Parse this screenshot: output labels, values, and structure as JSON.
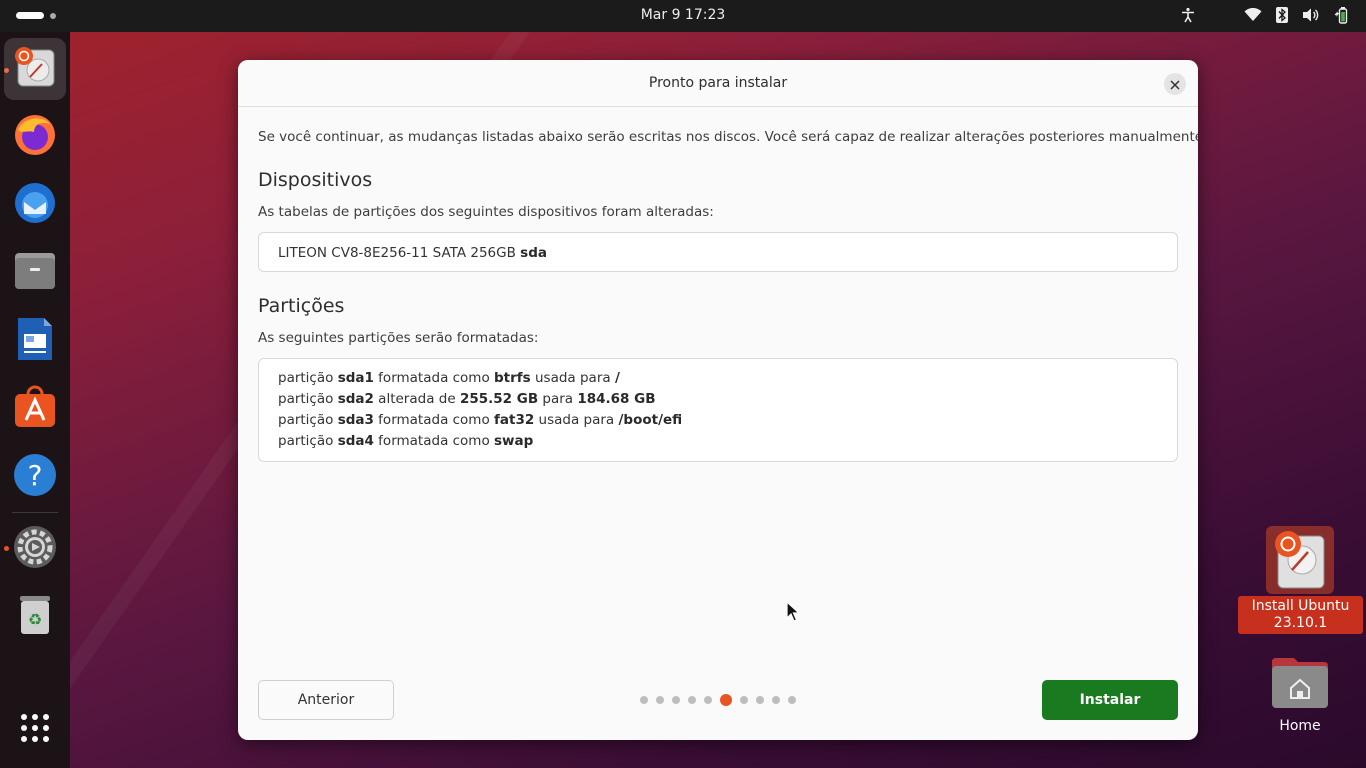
{
  "topbar": {
    "clock": "Mar 9  17:23",
    "tray_icons": [
      "accessibility-icon",
      "wifi-icon",
      "bluetooth-icon",
      "volume-icon",
      "battery-icon"
    ]
  },
  "dock": {
    "items": [
      {
        "name": "install-ubuntu",
        "icon": "installer-icon",
        "running": true,
        "active": true
      },
      {
        "name": "firefox",
        "icon": "firefox-icon"
      },
      {
        "name": "thunderbird",
        "icon": "thunderbird-icon"
      },
      {
        "name": "files",
        "icon": "files-icon"
      },
      {
        "name": "writer",
        "icon": "libreoffice-writer-icon"
      },
      {
        "name": "app-center",
        "icon": "app-center-icon"
      },
      {
        "name": "help",
        "icon": "help-icon"
      },
      {
        "name": "settings",
        "icon": "settings-icon",
        "running": true
      },
      {
        "name": "trash",
        "icon": "trash-icon"
      },
      {
        "name": "show-apps",
        "icon": "app-grid-icon"
      }
    ]
  },
  "dialog": {
    "title": "Pronto para instalar",
    "intro": "Se você continuar, as mudanças listadas abaixo serão escritas nos discos. Você será capaz de realizar alterações posteriores manualmente.",
    "devices": {
      "heading": "Dispositivos",
      "subtitle": "As tabelas de partições dos seguintes dispositivos foram alteradas:",
      "device_name": "LITEON CV8-8E256-11 SATA 256GB",
      "device_id": "sda"
    },
    "partitions": {
      "heading": "Partições",
      "subtitle": "As seguintes partições serão formatadas:",
      "lines": [
        [
          {
            "t": "partição "
          },
          {
            "t": "sda1",
            "b": true
          },
          {
            "t": " formatada como "
          },
          {
            "t": "btrfs",
            "b": true
          },
          {
            "t": " usada para "
          },
          {
            "t": "/",
            "b": true
          }
        ],
        [
          {
            "t": "partição "
          },
          {
            "t": "sda2",
            "b": true
          },
          {
            "t": " alterada de "
          },
          {
            "t": "255.52 GB",
            "b": true
          },
          {
            "t": " para "
          },
          {
            "t": "184.68 GB",
            "b": true
          }
        ],
        [
          {
            "t": "partição "
          },
          {
            "t": "sda3",
            "b": true
          },
          {
            "t": " formatada como "
          },
          {
            "t": "fat32",
            "b": true
          },
          {
            "t": " usada para "
          },
          {
            "t": "/boot/efi",
            "b": true
          }
        ],
        [
          {
            "t": "partição "
          },
          {
            "t": "sda4",
            "b": true
          },
          {
            "t": " formatada como "
          },
          {
            "t": "swap",
            "b": true
          }
        ]
      ]
    },
    "back_label": "Anterior",
    "install_label": "Instalar",
    "pager": {
      "total": 10,
      "current": 6
    }
  },
  "desktop": {
    "install_icon_label": "Install Ubuntu 23.10.1",
    "home_label": "Home"
  },
  "colors": {
    "accent": "#e95420",
    "install_button": "#1a7a1f",
    "topbar": "#1b1b1b"
  }
}
